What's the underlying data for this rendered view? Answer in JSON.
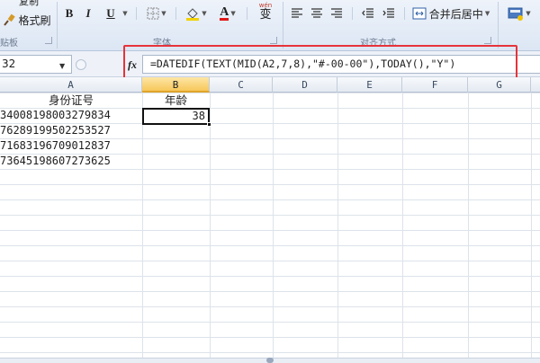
{
  "ribbon": {
    "clipboard": {
      "format_painter_label": "格式刷",
      "group_label": "贴板",
      "copy_label": "复制"
    },
    "font": {
      "bold_label": "B",
      "italic_label": "I",
      "underline_label": "U",
      "font_color_label": "A",
      "phonetic_label": "wén",
      "phonetic_char": "变",
      "group_label": "字体"
    },
    "alignment": {
      "merge_center_label": "合并后居中",
      "group_label": "对齐方式"
    }
  },
  "formula_bar": {
    "name_box": "32",
    "fx_label": "fx",
    "formula": "=DATEDIF(TEXT(MID(A2,7,8),\"#-00-00\"),TODAY(),\"Y\")"
  },
  "columns": [
    "A",
    "B",
    "C",
    "D",
    "E",
    "F",
    "G"
  ],
  "sheet": {
    "header_id": "身份证号",
    "header_age": "年龄",
    "ids": [
      "34008198003279834",
      "76289199502253527",
      "71683196709012837",
      "73645198607273625"
    ],
    "age_value": "38"
  },
  "colors": {
    "highlight": "#e6333a",
    "selected_col": "#f7c75b"
  }
}
